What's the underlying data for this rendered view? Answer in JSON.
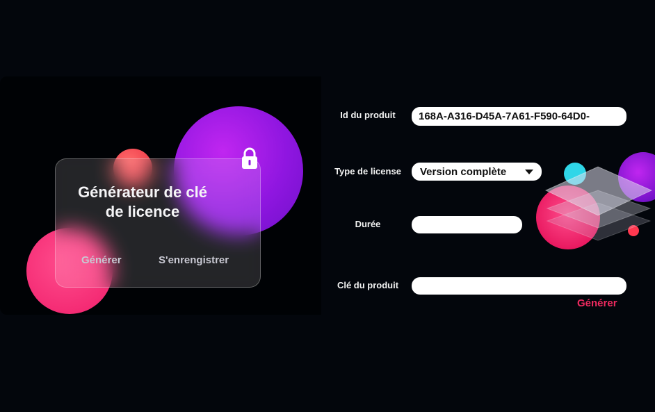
{
  "card": {
    "title_line1": "Générateur de clé",
    "title_line2": "de licence",
    "generate_label": "Générer",
    "register_label": "S'enrengistrer"
  },
  "form": {
    "product_id_label": "Id du produit",
    "product_id_value": "168A-A316-D45A-7A61-F590-64D0-",
    "license_type_label": "Type de license",
    "license_type_value": "Version complète",
    "duration_label": "Durée",
    "duration_value": "",
    "product_key_label": "Clé du produit",
    "product_key_value": "",
    "generate_label": "Générer"
  },
  "icons": {
    "lock": "lock-icon",
    "dropdown": "chevron-down-icon"
  },
  "colors": {
    "background": "#03060c",
    "accent_pink": "#ee2a5f",
    "blob_purple": "#9a1be6",
    "blob_pink": "#f01e6a"
  }
}
